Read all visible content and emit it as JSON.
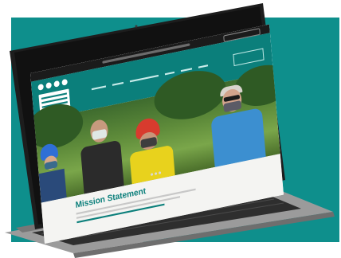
{
  "photo": {
    "subject": "",
    "colors": {
      "background": "#0e8f8c",
      "laptop_body": "#9a9a9a",
      "site_header": "#0b7f7b",
      "accent_text": "#0b7f7b"
    }
  },
  "website": {
    "mission_heading": "Mission Statement",
    "carousel_dots": 3
  }
}
